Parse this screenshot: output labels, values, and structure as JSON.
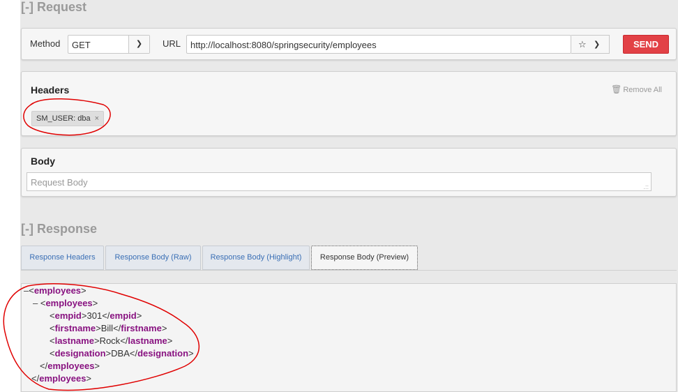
{
  "request": {
    "title": "[-] Request",
    "method_label": "Method",
    "method_value": "GET",
    "url_label": "URL",
    "url_value": "http://localhost:8080/springsecurity/employees",
    "send_label": "SEND",
    "headers_title": "Headers",
    "remove_all_label": "Remove All",
    "header_chip": "SM_USER: dba",
    "body_title": "Body",
    "body_placeholder": "Request Body"
  },
  "response": {
    "title": "[-] Response",
    "tabs": [
      {
        "label": "Response Headers",
        "active": false
      },
      {
        "label": "Response Body (Raw)",
        "active": false
      },
      {
        "label": "Response Body (Highlight)",
        "active": false
      },
      {
        "label": "Response Body (Preview)",
        "active": true
      }
    ],
    "xml": {
      "root": "employees",
      "item": "employees",
      "fields": [
        {
          "tag": "empid",
          "value": "301"
        },
        {
          "tag": "firstname",
          "value": "Bill"
        },
        {
          "tag": "lastname",
          "value": "Rock"
        },
        {
          "tag": "designation",
          "value": "DBA"
        }
      ]
    }
  },
  "icons": {
    "star": "star-icon",
    "chevron": "chevron-down-icon",
    "trash": "trash-icon",
    "close": "close-icon"
  },
  "colors": {
    "send": "#e24146",
    "tag": "#881280",
    "tab_link": "#3a6fb5",
    "annotation": "#e00000"
  }
}
